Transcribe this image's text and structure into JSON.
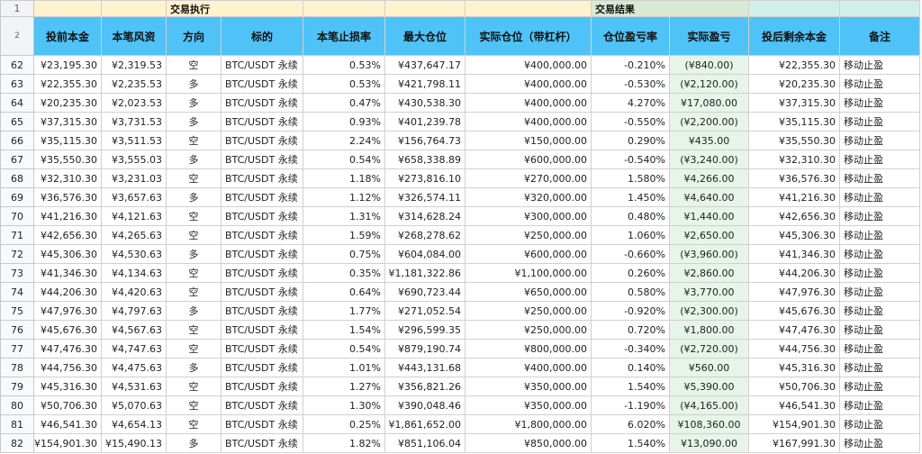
{
  "sheet": {
    "row_header_top": "1",
    "row_header_cols": "2",
    "group_headers": {
      "execution": "交易执行",
      "result": "交易结果"
    },
    "columns": [
      "投前本金",
      "本笔风资",
      "方向",
      "标的",
      "本笔止损率",
      "最大仓位",
      "实际仓位（带杠杆）",
      "仓位盈亏率",
      "实际盈亏",
      "投后剩余本金",
      "备注"
    ],
    "rows": [
      {
        "n": "62",
        "pre": "¥23,195.30",
        "risk": "¥2,319.53",
        "dir": "空",
        "asset": "BTC/USDT 永续",
        "stop": "0.53%",
        "max": "¥437,647.17",
        "pos": "¥400,000.00",
        "rate": "-0.210%",
        "pnl": "(¥840.00)",
        "sign": "neg",
        "post": "¥22,355.30",
        "note": "移动止盈"
      },
      {
        "n": "63",
        "pre": "¥22,355.30",
        "risk": "¥2,235.53",
        "dir": "多",
        "asset": "BTC/USDT 永续",
        "stop": "0.53%",
        "max": "¥421,798.11",
        "pos": "¥400,000.00",
        "rate": "-0.530%",
        "pnl": "(¥2,120.00)",
        "sign": "neg",
        "post": "¥20,235.30",
        "note": "移动止盈"
      },
      {
        "n": "64",
        "pre": "¥20,235.30",
        "risk": "¥2,023.53",
        "dir": "多",
        "asset": "BTC/USDT 永续",
        "stop": "0.47%",
        "max": "¥430,538.30",
        "pos": "¥400,000.00",
        "rate": "4.270%",
        "pnl": "¥17,080.00",
        "sign": "pos",
        "post": "¥37,315.30",
        "note": "移动止盈"
      },
      {
        "n": "65",
        "pre": "¥37,315.30",
        "risk": "¥3,731.53",
        "dir": "多",
        "asset": "BTC/USDT 永续",
        "stop": "0.93%",
        "max": "¥401,239.78",
        "pos": "¥400,000.00",
        "rate": "-0.550%",
        "pnl": "(¥2,200.00)",
        "sign": "neg",
        "post": "¥35,115.30",
        "note": "移动止盈"
      },
      {
        "n": "66",
        "pre": "¥35,115.30",
        "risk": "¥3,511.53",
        "dir": "空",
        "asset": "BTC/USDT 永续",
        "stop": "2.24%",
        "max": "¥156,764.73",
        "pos": "¥150,000.00",
        "rate": "0.290%",
        "pnl": "¥435.00",
        "sign": "pos",
        "post": "¥35,550.30",
        "note": "移动止盈"
      },
      {
        "n": "67",
        "pre": "¥35,550.30",
        "risk": "¥3,555.03",
        "dir": "多",
        "asset": "BTC/USDT 永续",
        "stop": "0.54%",
        "max": "¥658,338.89",
        "pos": "¥600,000.00",
        "rate": "-0.540%",
        "pnl": "(¥3,240.00)",
        "sign": "neg",
        "post": "¥32,310.30",
        "note": "移动止盈"
      },
      {
        "n": "68",
        "pre": "¥32,310.30",
        "risk": "¥3,231.03",
        "dir": "空",
        "asset": "BTC/USDT 永续",
        "stop": "1.18%",
        "max": "¥273,816.10",
        "pos": "¥270,000.00",
        "rate": "1.580%",
        "pnl": "¥4,266.00",
        "sign": "pos",
        "post": "¥36,576.30",
        "note": "移动止盈"
      },
      {
        "n": "69",
        "pre": "¥36,576.30",
        "risk": "¥3,657.63",
        "dir": "多",
        "asset": "BTC/USDT 永续",
        "stop": "1.12%",
        "max": "¥326,574.11",
        "pos": "¥320,000.00",
        "rate": "1.450%",
        "pnl": "¥4,640.00",
        "sign": "pos",
        "post": "¥41,216.30",
        "note": "移动止盈"
      },
      {
        "n": "70",
        "pre": "¥41,216.30",
        "risk": "¥4,121.63",
        "dir": "空",
        "asset": "BTC/USDT 永续",
        "stop": "1.31%",
        "max": "¥314,628.24",
        "pos": "¥300,000.00",
        "rate": "0.480%",
        "pnl": "¥1,440.00",
        "sign": "pos",
        "post": "¥42,656.30",
        "note": "移动止盈"
      },
      {
        "n": "71",
        "pre": "¥42,656.30",
        "risk": "¥4,265.63",
        "dir": "空",
        "asset": "BTC/USDT 永续",
        "stop": "1.59%",
        "max": "¥268,278.62",
        "pos": "¥250,000.00",
        "rate": "1.060%",
        "pnl": "¥2,650.00",
        "sign": "pos",
        "post": "¥45,306.30",
        "note": "移动止盈"
      },
      {
        "n": "72",
        "pre": "¥45,306.30",
        "risk": "¥4,530.63",
        "dir": "多",
        "asset": "BTC/USDT 永续",
        "stop": "0.75%",
        "max": "¥604,084.00",
        "pos": "¥600,000.00",
        "rate": "-0.660%",
        "pnl": "(¥3,960.00)",
        "sign": "neg",
        "post": "¥41,346.30",
        "note": "移动止盈"
      },
      {
        "n": "73",
        "pre": "¥41,346.30",
        "risk": "¥4,134.63",
        "dir": "空",
        "asset": "BTC/USDT 永续",
        "stop": "0.35%",
        "max": "¥1,181,322.86",
        "pos": "¥1,100,000.00",
        "rate": "0.260%",
        "pnl": "¥2,860.00",
        "sign": "pos",
        "post": "¥44,206.30",
        "note": "移动止盈"
      },
      {
        "n": "74",
        "pre": "¥44,206.30",
        "risk": "¥4,420.63",
        "dir": "空",
        "asset": "BTC/USDT 永续",
        "stop": "0.64%",
        "max": "¥690,723.44",
        "pos": "¥650,000.00",
        "rate": "0.580%",
        "pnl": "¥3,770.00",
        "sign": "pos",
        "post": "¥47,976.30",
        "note": "移动止盈"
      },
      {
        "n": "75",
        "pre": "¥47,976.30",
        "risk": "¥4,797.63",
        "dir": "多",
        "asset": "BTC/USDT 永续",
        "stop": "1.77%",
        "max": "¥271,052.54",
        "pos": "¥250,000.00",
        "rate": "-0.920%",
        "pnl": "(¥2,300.00)",
        "sign": "neg",
        "post": "¥45,676.30",
        "note": "移动止盈"
      },
      {
        "n": "76",
        "pre": "¥45,676.30",
        "risk": "¥4,567.63",
        "dir": "空",
        "asset": "BTC/USDT 永续",
        "stop": "1.54%",
        "max": "¥296,599.35",
        "pos": "¥250,000.00",
        "rate": "0.720%",
        "pnl": "¥1,800.00",
        "sign": "pos",
        "post": "¥47,476.30",
        "note": "移动止盈"
      },
      {
        "n": "77",
        "pre": "¥47,476.30",
        "risk": "¥4,747.63",
        "dir": "空",
        "asset": "BTC/USDT 永续",
        "stop": "0.54%",
        "max": "¥879,190.74",
        "pos": "¥800,000.00",
        "rate": "-0.340%",
        "pnl": "(¥2,720.00)",
        "sign": "neg",
        "post": "¥44,756.30",
        "note": "移动止盈"
      },
      {
        "n": "78",
        "pre": "¥44,756.30",
        "risk": "¥4,475.63",
        "dir": "多",
        "asset": "BTC/USDT 永续",
        "stop": "1.01%",
        "max": "¥443,131.68",
        "pos": "¥400,000.00",
        "rate": "0.140%",
        "pnl": "¥560.00",
        "sign": "pos",
        "post": "¥45,316.30",
        "note": "移动止盈"
      },
      {
        "n": "79",
        "pre": "¥45,316.30",
        "risk": "¥4,531.63",
        "dir": "空",
        "asset": "BTC/USDT 永续",
        "stop": "1.27%",
        "max": "¥356,821.26",
        "pos": "¥350,000.00",
        "rate": "1.540%",
        "pnl": "¥5,390.00",
        "sign": "pos",
        "post": "¥50,706.30",
        "note": "移动止盈"
      },
      {
        "n": "80",
        "pre": "¥50,706.30",
        "risk": "¥5,070.63",
        "dir": "空",
        "asset": "BTC/USDT 永续",
        "stop": "1.30%",
        "max": "¥390,048.46",
        "pos": "¥350,000.00",
        "rate": "-1.190%",
        "pnl": "(¥4,165.00)",
        "sign": "neg",
        "post": "¥46,541.30",
        "note": "移动止盈"
      },
      {
        "n": "81",
        "pre": "¥46,541.30",
        "risk": "¥4,654.13",
        "dir": "空",
        "asset": "BTC/USDT 永续",
        "stop": "0.25%",
        "max": "¥1,861,652.00",
        "pos": "¥1,800,000.00",
        "rate": "6.020%",
        "pnl": "¥108,360.00",
        "sign": "pos",
        "post": "¥154,901.30",
        "note": "移动止盈"
      },
      {
        "n": "82",
        "pre": "¥154,901.30",
        "risk": "¥15,490.13",
        "dir": "多",
        "asset": "BTC/USDT 永续",
        "stop": "1.82%",
        "max": "¥851,106.04",
        "pos": "¥850,000.00",
        "rate": "1.540%",
        "pnl": "¥13,090.00",
        "sign": "pos",
        "post": "¥167,991.30",
        "note": "移动止盈"
      }
    ]
  },
  "colors": {
    "header_blue": "#4fc3f7",
    "section_yellow": "#fff2cc",
    "section_green": "#d9ead3",
    "profit_green": "#188038",
    "loss_red": "#d93025"
  }
}
